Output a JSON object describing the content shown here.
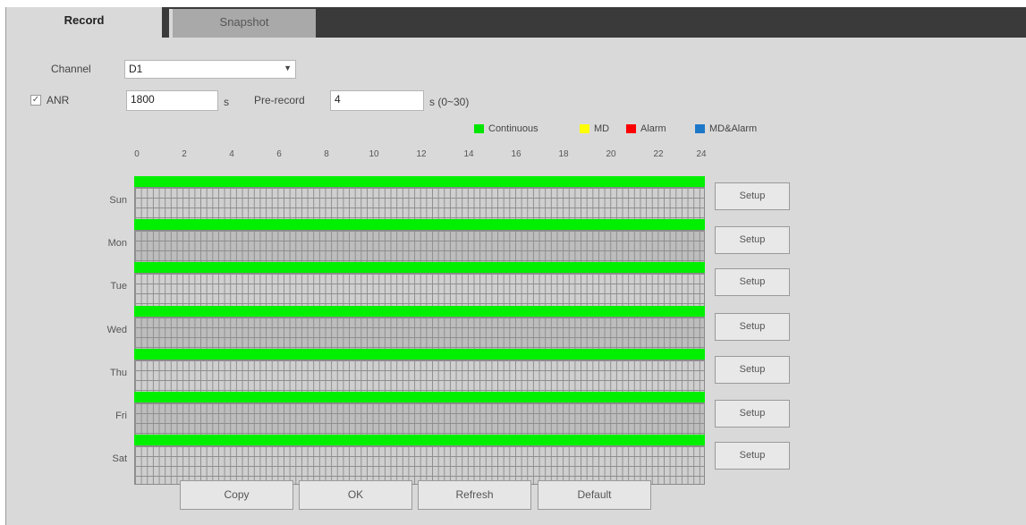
{
  "tabs": [
    {
      "label": "Record",
      "active": true
    },
    {
      "label": "Snapshot",
      "active": false
    }
  ],
  "channel": {
    "label": "Channel",
    "value": "D1"
  },
  "anr": {
    "label": "ANR",
    "checked": true,
    "value": "1800",
    "unit": "s"
  },
  "prerecord": {
    "label": "Pre-record",
    "value": "4",
    "unit": "s (0~30)"
  },
  "legend": [
    {
      "label": "Continuous",
      "color": "#00e600"
    },
    {
      "label": "MD",
      "color": "#ffff00"
    },
    {
      "label": "Alarm",
      "color": "#ff0000"
    },
    {
      "label": "MD&Alarm",
      "color": "#1e78c8"
    }
  ],
  "hours": [
    "0",
    "2",
    "4",
    "6",
    "8",
    "10",
    "12",
    "14",
    "16",
    "18",
    "20",
    "22",
    "24"
  ],
  "days": [
    {
      "label": "Sun",
      "record": "Continuous",
      "start": "0",
      "end": "24"
    },
    {
      "label": "Mon",
      "record": "Continuous",
      "start": "0",
      "end": "24"
    },
    {
      "label": "Tue",
      "record": "Continuous",
      "start": "0",
      "end": "24"
    },
    {
      "label": "Wed",
      "record": "Continuous",
      "start": "0",
      "end": "24"
    },
    {
      "label": "Thu",
      "record": "Continuous",
      "start": "0",
      "end": "24"
    },
    {
      "label": "Fri",
      "record": "Continuous",
      "start": "0",
      "end": "24"
    },
    {
      "label": "Sat",
      "record": "Continuous",
      "start": "0",
      "end": "24"
    }
  ],
  "setup_label": "Setup",
  "buttons": {
    "copy": "Copy",
    "ok": "OK",
    "refresh": "Refresh",
    "default": "Default"
  }
}
